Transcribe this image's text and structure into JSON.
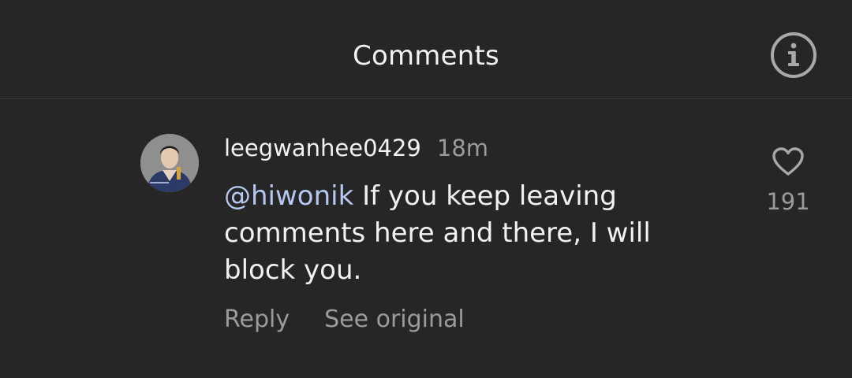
{
  "header": {
    "title": "Comments",
    "info_icon": "info-icon"
  },
  "comment": {
    "avatar_icon": "avatar",
    "username": "leegwanhee0429",
    "time": "18m",
    "mention": "@hiwonik",
    "text": " If you keep leaving comments here and there, I will block you.",
    "actions": {
      "reply": "Reply",
      "see_original": "See original"
    },
    "like_icon": "heart-icon",
    "like_count": "191"
  },
  "colors": {
    "background": "#262626",
    "text": "#f2f2f2",
    "muted": "#9b9b9b",
    "mention": "#b8c7f2",
    "divider": "#3a3a3a"
  }
}
